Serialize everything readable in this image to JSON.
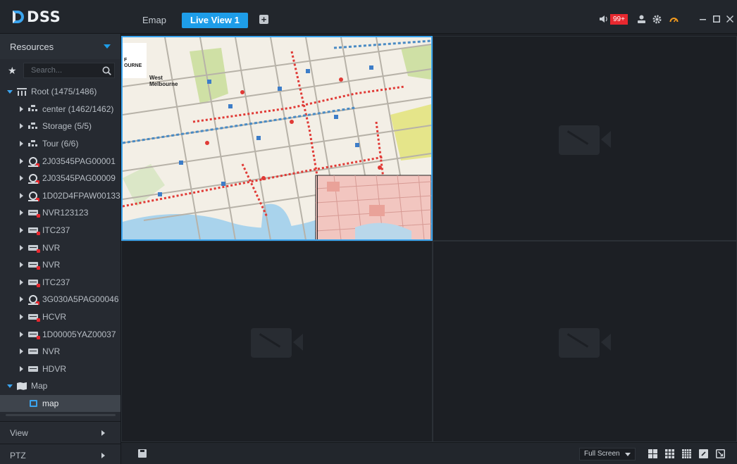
{
  "app": {
    "logo_text": "DSS"
  },
  "tabs": [
    {
      "label": "Emap",
      "active": false
    },
    {
      "label": "Live View 1",
      "active": true
    }
  ],
  "header_right": {
    "alarm_count": "99+"
  },
  "sidebar": {
    "resources_label": "Resources",
    "search_placeholder": "Search...",
    "tree": [
      {
        "label": "Root (1475/1486)",
        "icon": "org-icon",
        "level": 0,
        "expanded": true
      },
      {
        "label": "center (1462/1462)",
        "icon": "network-icon",
        "level": 1
      },
      {
        "label": "Storage (5/5)",
        "icon": "network-icon",
        "level": 1
      },
      {
        "label": "Tour (6/6)",
        "icon": "network-icon",
        "level": 1
      },
      {
        "label": "2J03545PAG00001",
        "icon": "camera-device-icon",
        "level": 1
      },
      {
        "label": "2J03545PAG00009",
        "icon": "camera-device-icon",
        "level": 1
      },
      {
        "label": "1D02D4FPAW00133",
        "icon": "camera-device-icon",
        "level": 1
      },
      {
        "label": "NVR123123",
        "icon": "nvr-alarm-icon",
        "level": 1
      },
      {
        "label": "ITC237",
        "icon": "nvr-alarm-icon",
        "level": 1
      },
      {
        "label": "NVR",
        "icon": "nvr-alarm-icon",
        "level": 1
      },
      {
        "label": "NVR",
        "icon": "nvr-alarm-icon",
        "level": 1
      },
      {
        "label": "ITC237",
        "icon": "nvr-alarm-icon",
        "level": 1
      },
      {
        "label": "3G030A5PAG00046",
        "icon": "camera-device-icon",
        "level": 1
      },
      {
        "label": "HCVR",
        "icon": "nvr-alarm-icon",
        "level": 1
      },
      {
        "label": "1D00005YAZ00037",
        "icon": "nvr-alarm-icon",
        "level": 1
      },
      {
        "label": "NVR",
        "icon": "nvr-icon",
        "level": 1
      },
      {
        "label": "HDVR",
        "icon": "nvr-icon",
        "level": 1
      },
      {
        "label": "Map",
        "icon": "map-icon",
        "level": 0,
        "expanded": true
      },
      {
        "label": "map",
        "icon": "map-sub-icon",
        "level": 1,
        "selected": true
      }
    ],
    "view_label": "View",
    "ptz_label": "PTZ"
  },
  "map_labels": {
    "edge_label": "F\nOURNE",
    "area_label": "West\nMelbourne"
  },
  "bottombar": {
    "fullscreen_label": "Full Screen"
  },
  "colors": {
    "accent": "#1e9de8",
    "alarm": "#e8282f",
    "background": "#1a1d22"
  }
}
